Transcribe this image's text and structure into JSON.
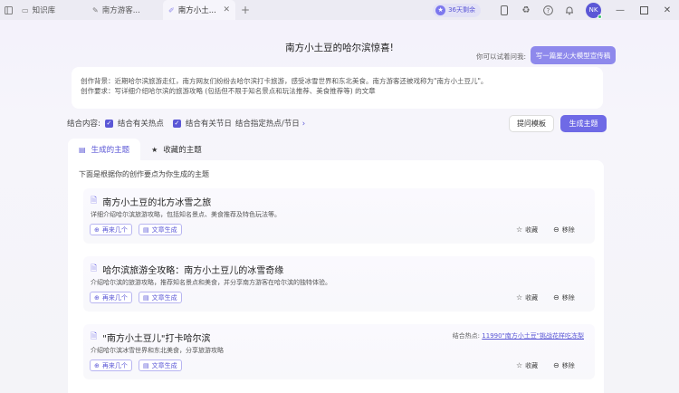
{
  "titlebar": {
    "tabs": [
      {
        "label": "知识库",
        "icon": "book-icon"
      },
      {
        "label": "南方游客...",
        "icon": "pen-icon"
      },
      {
        "label": "南方小土...",
        "icon": "magic-pen-icon"
      }
    ],
    "vip_label": "36天剩余",
    "avatar_initials": "NK"
  },
  "page_title": "南方小土豆的哈尔滨惊喜!",
  "try_label": "你可以试着问我:",
  "try_button": "写一篇星火大模型宣传稿",
  "prompt": {
    "background": "创作背景：近期哈尔滨旅游走红，南方网友们纷纷去哈尔滨打卡旅游，感受冰雪世界和东北美食。南方游客还被戏称为\"南方小土豆儿\"。",
    "requirement": "创作要求：写详细介绍哈尔滨的旅游攻略 (包括但不限于知名景点和玩法推荐、美食推荐等) 的文章"
  },
  "combine": {
    "label": "结合内容:",
    "option1": "结合有关热点",
    "option2": "结合有关节日",
    "link": "结合指定热点/节日"
  },
  "prompt_template_button": "提问模板",
  "generate_button": "生成主题",
  "tabs": {
    "generated": "生成的主题",
    "saved": "收藏的主题"
  },
  "intro": "下面是根据你的创作要点为你生成的主题",
  "cards": [
    {
      "title": "南方小土豆的北方冰雪之旅",
      "desc": "详细介绍哈尔滨旅游攻略，包括知名景点、美食推荐及特色玩法等。",
      "more": "再来几个",
      "write": "文章生成",
      "fav": "收藏",
      "remove": "移除"
    },
    {
      "title": "哈尔滨旅游全攻略：南方小土豆儿的冰雪奇缘",
      "desc": "介绍哈尔滨的旅游攻略，推荐知名景点和美食，并分享南方游客在哈尔滨的独特体验。",
      "more": "再来几个",
      "write": "文章生成",
      "fav": "收藏",
      "remove": "移除"
    },
    {
      "title": "\"南方小土豆儿\"打卡哈尔滨",
      "desc": "介绍哈尔滨冰雪世界和东北美食，分享旅游攻略",
      "more": "再来几个",
      "write": "文章生成",
      "fav": "收藏",
      "remove": "移除",
      "hot_label": "结合热点:",
      "hot_value": "11990\"南方小土豆\"挑战花样吃冻梨"
    }
  ]
}
